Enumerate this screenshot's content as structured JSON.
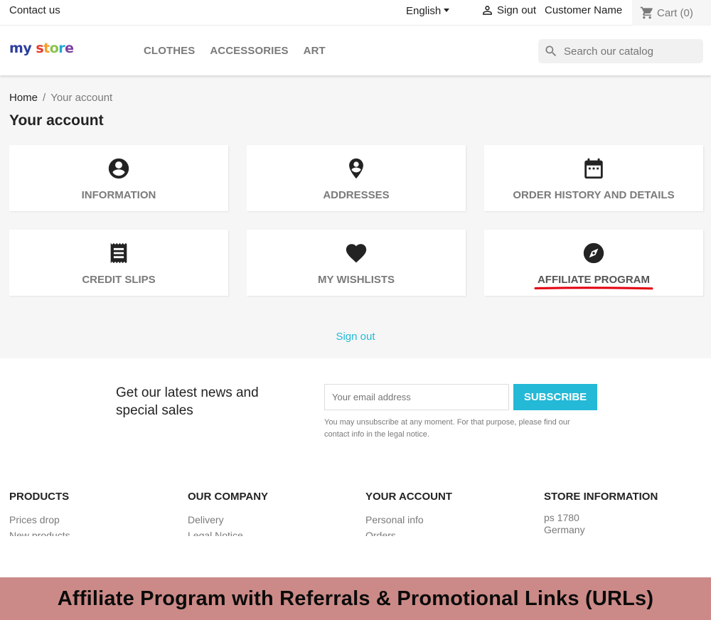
{
  "topbar": {
    "contact": "Contact us",
    "language": "English",
    "sign_out": "Sign out",
    "customer_name": "Customer Name",
    "cart": "Cart (0)"
  },
  "header": {
    "logo_letters": [
      "m",
      "y",
      " ",
      "s",
      "t",
      "o",
      "r",
      "e"
    ],
    "logo_colors": [
      "#2c3e9e",
      "#2c3e9e",
      "#ffffff",
      "#e5392d",
      "#f2a02a",
      "#8bc34a",
      "#1fa9d6",
      "#7b3fa0"
    ],
    "nav": [
      "CLOTHES",
      "ACCESSORIES",
      "ART"
    ],
    "search_placeholder": "Search our catalog"
  },
  "main": {
    "breadcrumb": [
      "Home",
      "Your account"
    ],
    "title": "Your account",
    "tiles": [
      {
        "label": "INFORMATION",
        "icon": "account-circle-icon"
      },
      {
        "label": "ADDRESSES",
        "icon": "location-pin-icon"
      },
      {
        "label": "ORDER HISTORY AND DETAILS",
        "icon": "calendar-icon"
      },
      {
        "label": "CREDIT SLIPS",
        "icon": "receipt-icon"
      },
      {
        "label": "MY WISHLISTS",
        "icon": "heart-icon"
      },
      {
        "label": "AFFILIATE PROGRAM",
        "icon": "compass-icon"
      }
    ],
    "sign_out": "Sign out",
    "highlight_color": "#e3000f"
  },
  "newsletter": {
    "title": "Get our latest news and special sales",
    "email_placeholder": "Your email address",
    "button": "SUBSCRIBE",
    "note": "You may unsubscribe at any moment. For that purpose, please find our contact info in the legal notice."
  },
  "footer": {
    "columns": [
      {
        "title": "PRODUCTS",
        "links": [
          "Prices drop",
          "New products"
        ]
      },
      {
        "title": "OUR COMPANY",
        "links": [
          "Delivery",
          "Legal Notice"
        ]
      },
      {
        "title": "YOUR ACCOUNT",
        "links": [
          "Personal info",
          "Orders"
        ]
      },
      {
        "title": "STORE INFORMATION",
        "links": [
          "ps 1780",
          "Germany"
        ]
      }
    ]
  },
  "banner": {
    "text": "Affiliate Program with Referrals & Promotional Links (URLs)",
    "color": "#cb8a87"
  },
  "colors": {
    "accent": "#24b9d7",
    "text": "#232323",
    "muted": "#7a7a7a"
  }
}
